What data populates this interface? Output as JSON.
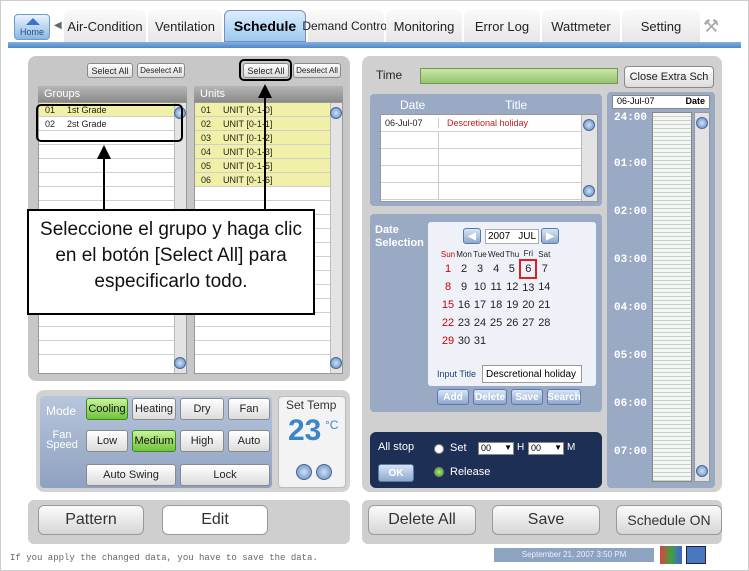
{
  "tabs": [
    {
      "label": "Home"
    },
    {
      "label": "Air-Condition"
    },
    {
      "label": "Ventilation"
    },
    {
      "label": "Schedule"
    },
    {
      "label": "Demand Control"
    },
    {
      "label": "Monitoring"
    },
    {
      "label": "Error Log"
    },
    {
      "label": "Wattmeter"
    },
    {
      "label": "Setting"
    }
  ],
  "groups": {
    "select_all": "Select All",
    "deselect_all": "Deselect All",
    "header": "Groups",
    "rows": [
      {
        "num": "01",
        "name": "1st Grade"
      },
      {
        "num": "02",
        "name": "2st Grade"
      }
    ]
  },
  "units": {
    "select_all": "Select All",
    "deselect_all": "Deselect All",
    "header": "Units",
    "rows": [
      {
        "num": "01",
        "name": "UNIT [0-1-0]"
      },
      {
        "num": "02",
        "name": "UNIT [0-1-1]"
      },
      {
        "num": "03",
        "name": "UNIT [0-1-2]"
      },
      {
        "num": "04",
        "name": "UNIT [0-1-3]"
      },
      {
        "num": "05",
        "name": "UNIT [0-1-5]"
      },
      {
        "num": "06",
        "name": "UNIT [0-1-6]"
      }
    ]
  },
  "callout": "Seleccione el grupo y haga clic en el botón [Select All] para especificarlo todo.",
  "control": {
    "mode_label": "Mode",
    "modes": [
      "Cooling",
      "Heating",
      "Dry",
      "Fan"
    ],
    "fan_label": "Fan Speed",
    "fans": [
      "Low",
      "Medium",
      "High",
      "Auto"
    ],
    "auto_swing": "Auto Swing",
    "lock": "Lock",
    "set_temp_label": "Set Temp",
    "temp": "23",
    "temp_unit": "°C"
  },
  "bottom_left": {
    "pattern": "Pattern",
    "edit": "Edit"
  },
  "schedule": {
    "time_label": "Time",
    "close_extra": "Close Extra Sch",
    "date_header": "Date",
    "title_header": "Title",
    "entries": [
      {
        "date": "06-Jul-07",
        "title": "Descretional holiday"
      }
    ],
    "timeline_date": "06-Jul-07",
    "timeline_label": "Date",
    "hours": [
      "24:00",
      "01:00",
      "02:00",
      "03:00",
      "04:00",
      "05:00",
      "06:00",
      "07:00"
    ]
  },
  "date_selection": {
    "label": "Date Selection",
    "year": "2007",
    "month": "JUL",
    "weekdays": [
      "Sun",
      "Mon",
      "Tue",
      "Wed",
      "Thu",
      "Fri",
      "Sat"
    ],
    "weeks": [
      [
        "",
        "",
        "",
        "",
        "",
        "",
        ""
      ],
      [
        "1",
        "2",
        "3",
        "4",
        "5",
        "6",
        "7"
      ],
      [
        "8",
        "9",
        "10",
        "11",
        "12",
        "13",
        "14"
      ],
      [
        "15",
        "16",
        "17",
        "18",
        "19",
        "20",
        "21"
      ],
      [
        "22",
        "23",
        "24",
        "25",
        "26",
        "27",
        "28"
      ],
      [
        "29",
        "30",
        "31",
        "",
        "",
        "",
        ""
      ]
    ],
    "input_label": "Input Title",
    "input_value": "Descretional holiday",
    "buttons": [
      "Add",
      "Delete",
      "Save",
      "Search"
    ]
  },
  "allstop": {
    "label": "All stop",
    "ok": "OK",
    "set": "Set",
    "h_val": "00",
    "h": "H",
    "m_val": "00",
    "m": "M",
    "release": "Release"
  },
  "bottom_right": {
    "delete_all": "Delete All",
    "save": "Save",
    "schedule_on": "Schedule ON"
  },
  "status": {
    "message": "If you apply the changed data,  you have to save the data.",
    "datetime": "September 21, 2007 3:50 PM"
  }
}
